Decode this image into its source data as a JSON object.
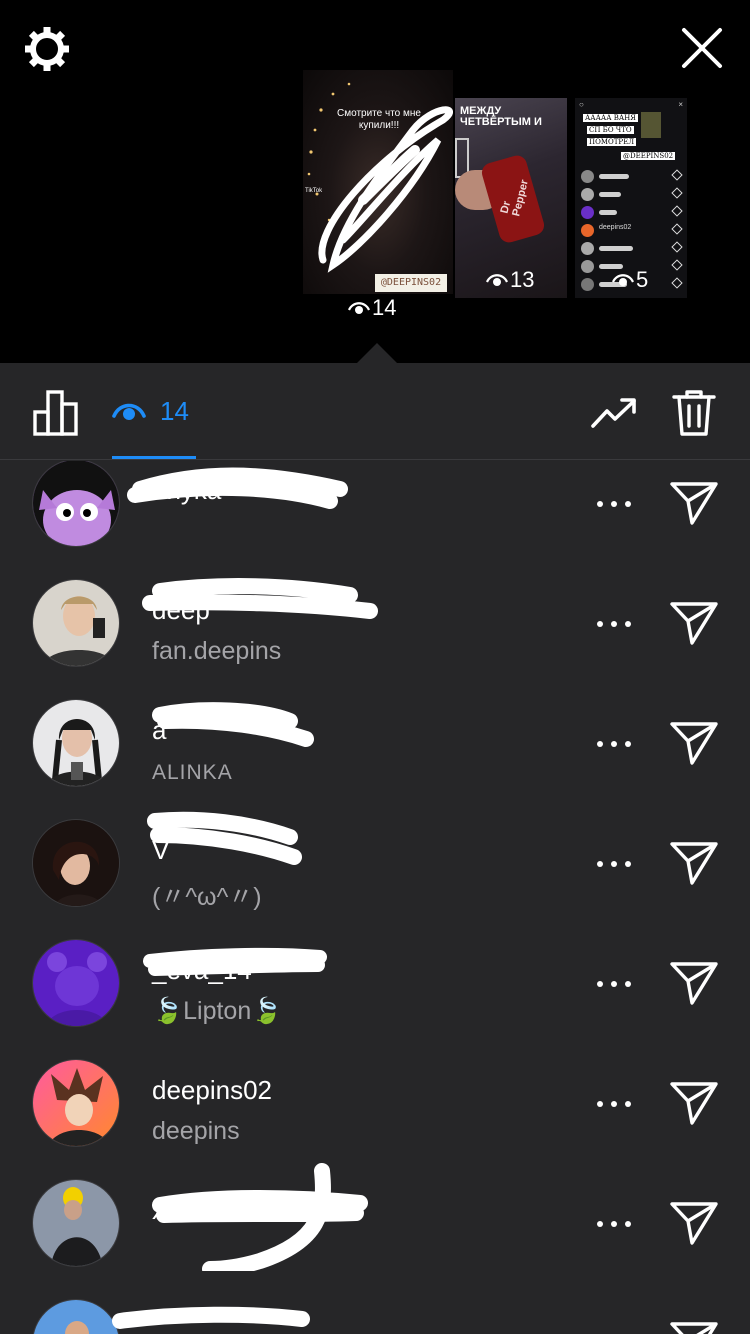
{
  "top": {
    "settings_icon": "gear-icon",
    "close_icon": "close-icon",
    "stories": [
      {
        "caption": "Смотрите что мне купили!!!",
        "tag": "@DEEPINS02",
        "views": "14",
        "side_label": "TikTok"
      },
      {
        "caption": "МЕЖДУ ЧЕТВЁРТЫМ И",
        "can_label": "Dr Pepper",
        "views": "13"
      },
      {
        "header_line1": "ААААА ВАНЯ",
        "header_line2": "СП БО ЧТО",
        "header_line3": "ПОМОТРЕЛ",
        "tag": "@DEEPINS02",
        "row_label": "deepins02",
        "views": "5"
      }
    ]
  },
  "toolbar": {
    "insights_icon": "bar-chart-icon",
    "viewers_icon": "eye-icon",
    "viewers_count": "14",
    "promote_icon": "trending-up-icon",
    "delete_icon": "trash-icon",
    "accent_color": "#1e8cf7"
  },
  "viewers": [
    {
      "username": "anyka",
      "fullname": "",
      "avatar": "purple-cartoon",
      "redacted": true
    },
    {
      "username": "deep",
      "fullname": "fan.deepins",
      "avatar": "boy-selfie",
      "redacted": true
    },
    {
      "username": "a",
      "fullname": "ALINKA",
      "avatar": "girl-braids",
      "redacted": true
    },
    {
      "username": "V",
      "fullname": "(〃^ω^〃)",
      "avatar": "girl-dark-hair",
      "redacted": true
    },
    {
      "username": "_eva_14",
      "fullname": "🍃Lipton🍃",
      "avatar": "purple-bear",
      "redacted": true
    },
    {
      "username": "deepins02",
      "fullname": "deepins",
      "avatar": "anime-boy-orange",
      "redacted": false
    },
    {
      "username": "x",
      "fullname": "",
      "avatar": "yellow-hat",
      "redacted": true
    },
    {
      "username": "",
      "fullname": "",
      "avatar": "blue-sky",
      "redacted": true
    }
  ],
  "row_actions": {
    "more_icon": "more-dots-icon",
    "send_icon": "send-icon"
  }
}
